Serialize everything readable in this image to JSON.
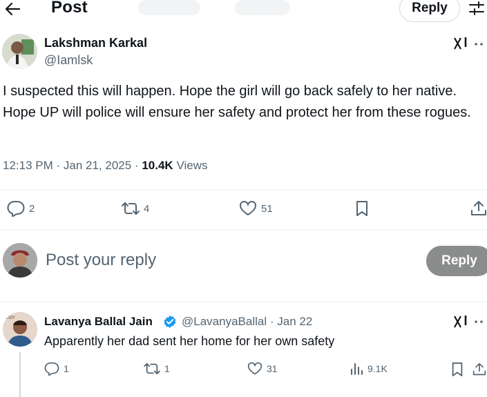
{
  "header": {
    "title": "Post",
    "reply_label": "Reply"
  },
  "tweet": {
    "author_name": "Lakshman Karkal",
    "author_handle": "@Iamlsk",
    "text": "I suspected this will happen. Hope the girl will go back safely to her native. Hope UP will police will ensure her safety and protect her from these rogues.",
    "time": "12:13 PM",
    "date": "Jan 21, 2025",
    "views_count": "10.4K",
    "views_label": "Views",
    "replies": "2",
    "reposts": "4",
    "likes": "51"
  },
  "compose": {
    "placeholder": "Post your reply",
    "button_label": "Reply",
    "button_color": "#8b8c8c"
  },
  "reply_tweet": {
    "author_name": "Lavanya Ballal Jain",
    "author_handle": "@LavanyaBallal",
    "date": "Jan 22",
    "text": "Apparently her dad sent her home for her own safety",
    "replies": "1",
    "reposts": "1",
    "likes": "31",
    "views": "9.1K",
    "verified_color": "#1d9bf0"
  },
  "colors": {
    "text": "#0f1419",
    "secondary": "#536471",
    "divider": "#eff3f4"
  },
  "icons": [
    "back-arrow-icon",
    "filter-icon",
    "grok-icon",
    "more-icon",
    "reply-icon",
    "repost-icon",
    "like-icon",
    "bookmark-icon",
    "share-icon",
    "views-icon",
    "verified-icon"
  ]
}
